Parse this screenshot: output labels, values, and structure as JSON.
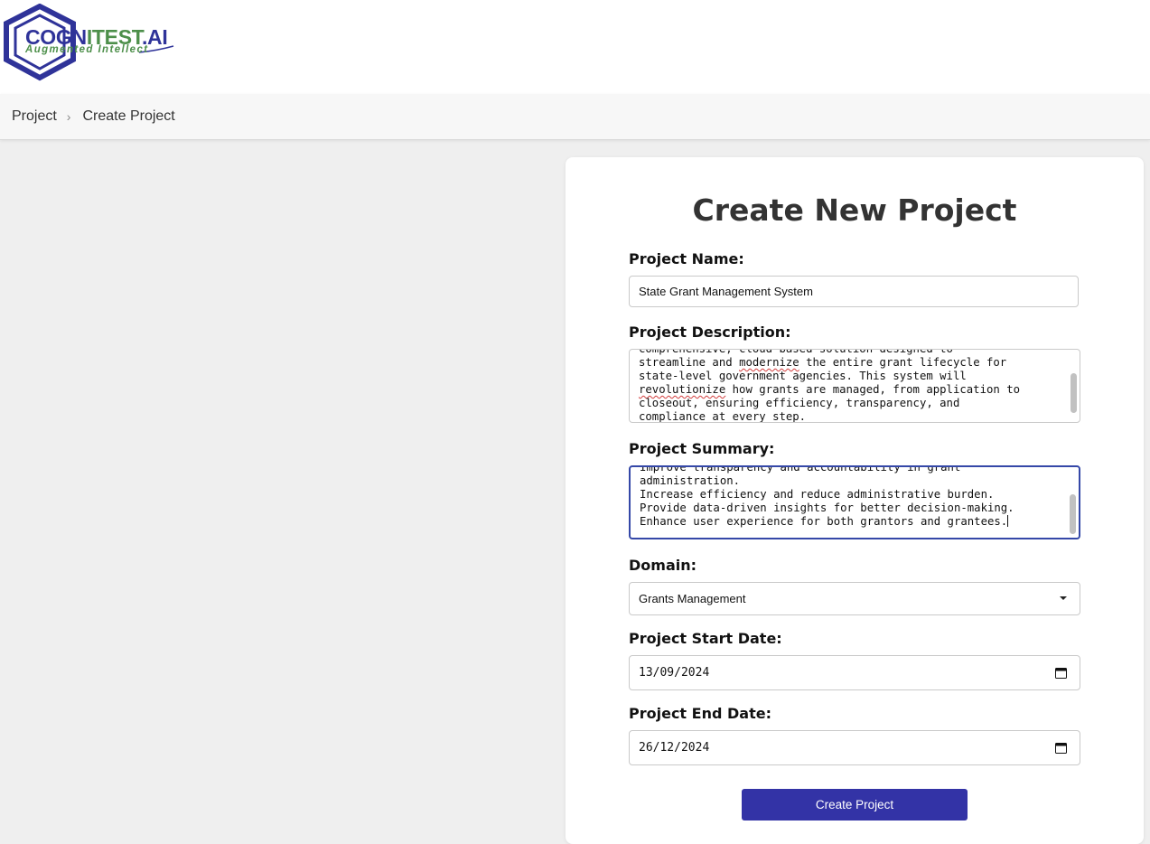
{
  "brand": {
    "name_part1": "COGN",
    "name_part2": "ITEST",
    "name_part3": ".AI",
    "tagline": "Augmented Intellect",
    "primary_color": "#2f3399",
    "secondary_color": "#4d8f4a"
  },
  "breadcrumb": {
    "items": [
      "Project",
      "Create Project"
    ],
    "separator": "›"
  },
  "form": {
    "title": "Create New Project",
    "project_name": {
      "label": "Project Name:",
      "value": "State Grant Management System"
    },
    "project_description": {
      "label": "Project Description:",
      "lines": [
        "comprehensive, cloud-based solution designed to",
        "streamline and ",
        "state-level government agencies. This system will",
        "",
        "closeout, ensuring efficiency, transparency, and",
        "compliance at every step."
      ],
      "misspelled_1": "modernize",
      "line2_rest": " the entire grant lifecycle for",
      "misspelled_2": "revolutionize",
      "line4_rest": " how grants are managed, from application to"
    },
    "project_summary": {
      "label": "Project Summary:",
      "lines": [
        "Improve transparency and accountability in grant",
        "administration.",
        "Increase efficiency and reduce administrative burden.",
        "Provide data-driven insights for better decision-making.",
        "Enhance user experience for both grantors and grantees."
      ]
    },
    "domain": {
      "label": "Domain:",
      "selected": "Grants Management"
    },
    "start_date": {
      "label": "Project Start Date:",
      "value": "13/09/2024"
    },
    "end_date": {
      "label": "Project End Date:",
      "value": "26/12/2024"
    },
    "submit_label": "Create Project",
    "submit_color": "#3333a6"
  }
}
